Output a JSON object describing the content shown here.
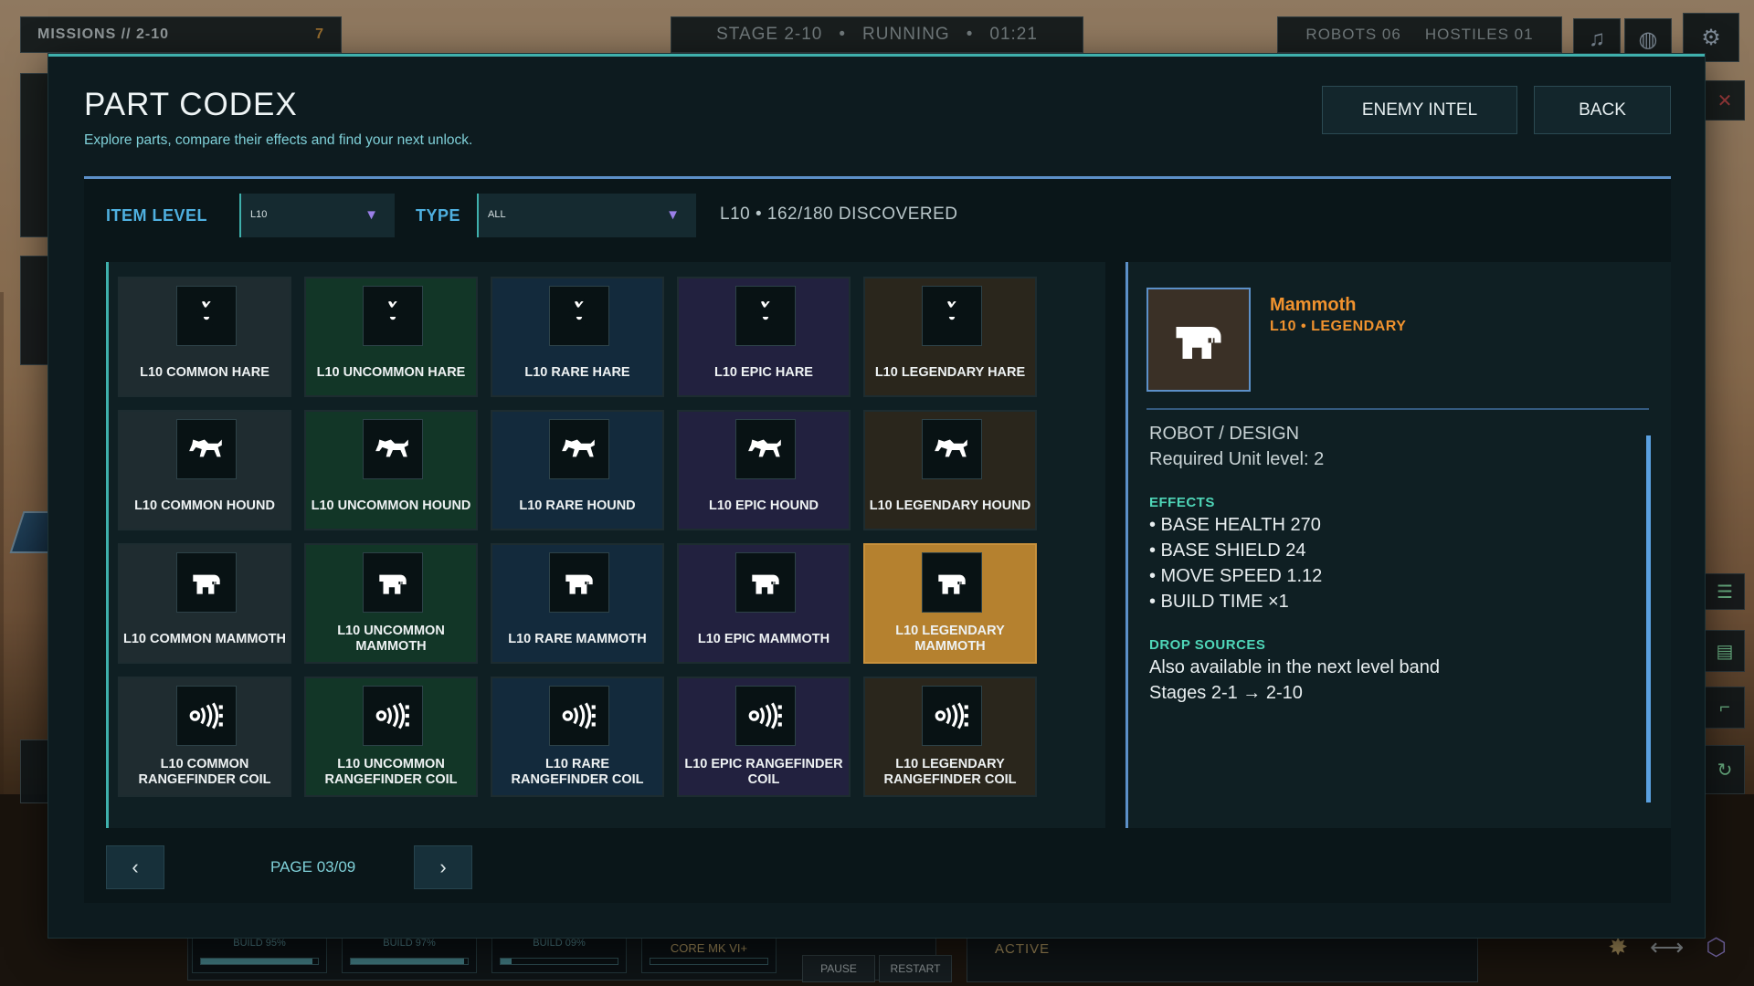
{
  "hud": {
    "missions_label": "MISSIONS // 2-10",
    "missions_count": "7",
    "stage_text": "STAGE 2-10",
    "run_state": "RUNNING",
    "timer": "01:21",
    "robots": "ROBOTS 06",
    "hostiles": "HOSTILES 01",
    "build_slots": [
      {
        "label": "BUILD 95%",
        "progress": 0.95
      },
      {
        "label": "BUILD 97%",
        "progress": 0.97
      },
      {
        "label": "BUILD 09%",
        "progress": 0.09
      },
      {
        "label": "CORE MK VI+",
        "progress": 0
      }
    ],
    "pause_label": "PAUSE",
    "restart_label": "RESTART",
    "status_label": "ACTIVE"
  },
  "codex": {
    "title": "PART CODEX",
    "subtitle": "Explore parts, compare their effects and find your next unlock.",
    "enemy_intel_label": "ENEMY INTEL",
    "back_label": "BACK",
    "filters": {
      "item_level_label": "ITEM LEVEL",
      "item_level_value": "L10",
      "type_label": "TYPE",
      "type_value": "ALL",
      "discovered": "L10 • 162/180 DISCOVERED"
    },
    "rows": [
      {
        "icon": "hare-icon",
        "cards": [
          {
            "label": "L10 COMMON HARE",
            "rarity": "common"
          },
          {
            "label": "L10 UNCOMMON HARE",
            "rarity": "uncommon"
          },
          {
            "label": "L10 RARE HARE",
            "rarity": "rare"
          },
          {
            "label": "L10 EPIC HARE",
            "rarity": "epic"
          },
          {
            "label": "L10 LEGENDARY HARE",
            "rarity": "legendary"
          }
        ]
      },
      {
        "icon": "hound-icon",
        "cards": [
          {
            "label": "L10 COMMON HOUND",
            "rarity": "common"
          },
          {
            "label": "L10 UNCOMMON HOUND",
            "rarity": "uncommon"
          },
          {
            "label": "L10 RARE HOUND",
            "rarity": "rare"
          },
          {
            "label": "L10 EPIC HOUND",
            "rarity": "epic"
          },
          {
            "label": "L10 LEGENDARY HOUND",
            "rarity": "legendary"
          }
        ]
      },
      {
        "icon": "mammoth-icon",
        "cards": [
          {
            "label": "L10 COMMON MAMMOTH",
            "rarity": "common"
          },
          {
            "label": "L10 UNCOMMON MAMMOTH",
            "rarity": "uncommon"
          },
          {
            "label": "L10 RARE MAMMOTH",
            "rarity": "rare"
          },
          {
            "label": "L10 EPIC MAMMOTH",
            "rarity": "epic"
          },
          {
            "label": "L10 LEGENDARY MAMMOTH",
            "rarity": "legendary",
            "selected": true
          }
        ]
      },
      {
        "icon": "rangefinder-coil-icon",
        "cards": [
          {
            "label": "L10 COMMON RANGEFINDER COIL",
            "rarity": "common"
          },
          {
            "label": "L10 UNCOMMON RANGEFINDER COIL",
            "rarity": "uncommon"
          },
          {
            "label": "L10 RARE RANGEFINDER COIL",
            "rarity": "rare"
          },
          {
            "label": "L10 EPIC RANGEFINDER COIL",
            "rarity": "epic"
          },
          {
            "label": "L10 LEGENDARY RANGEFINDER COIL",
            "rarity": "legendary"
          }
        ]
      }
    ],
    "detail": {
      "name": "Mammoth",
      "rarity_line": "L10 • LEGENDARY",
      "category": "ROBOT / DESIGN",
      "required": "Required Unit level: 2",
      "effects_label": "EFFECTS",
      "effects": [
        "• BASE HEALTH 270",
        "• BASE SHIELD 24",
        "• MOVE SPEED 1.12",
        "• BUILD TIME ×1"
      ],
      "drop_label": "DROP SOURCES",
      "drop_lines": [
        "Also available in the next level band",
        "Stages 2-1 → 2-10"
      ]
    },
    "pager": {
      "prev": "‹",
      "next": "›",
      "page": "PAGE 03/09"
    }
  },
  "colors": {
    "accent_teal": "#3fb0ac",
    "accent_blue": "#5c90c8",
    "legendary_orange": "#f0922e",
    "selected_card": "#b5812f"
  }
}
